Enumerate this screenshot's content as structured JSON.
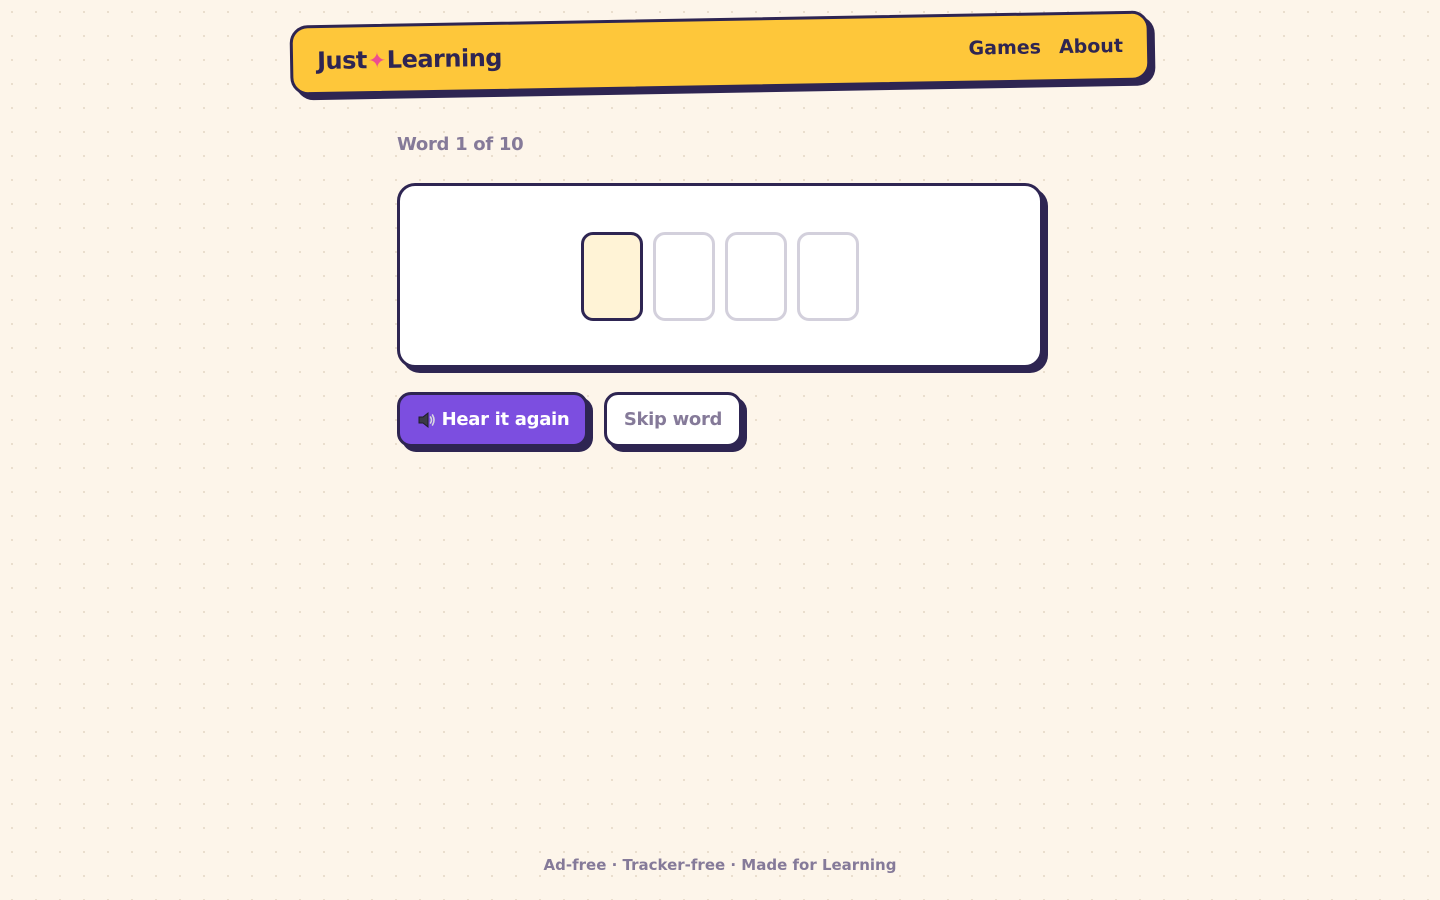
{
  "header": {
    "logo_left": "Just",
    "logo_spark": "✦",
    "logo_right": "Learning",
    "nav": [
      "Games",
      "About"
    ]
  },
  "game": {
    "progress": "Word 1 of 10",
    "slots": [
      "",
      "",
      "",
      ""
    ],
    "active_slot": 1
  },
  "actions": {
    "hear_again": "Hear it again",
    "speaker_icon": "speaker-icon",
    "skip": "Skip word"
  },
  "footer": {
    "text": "Ad-free · Tracker-free · Made for Learning"
  },
  "colors": {
    "background": "#fdf5ea",
    "nav_bg": "#fec73a",
    "ink": "#2e2552",
    "accent": "#7c4ee0",
    "spark": "#ee4d8f",
    "muted": "#857a99"
  }
}
